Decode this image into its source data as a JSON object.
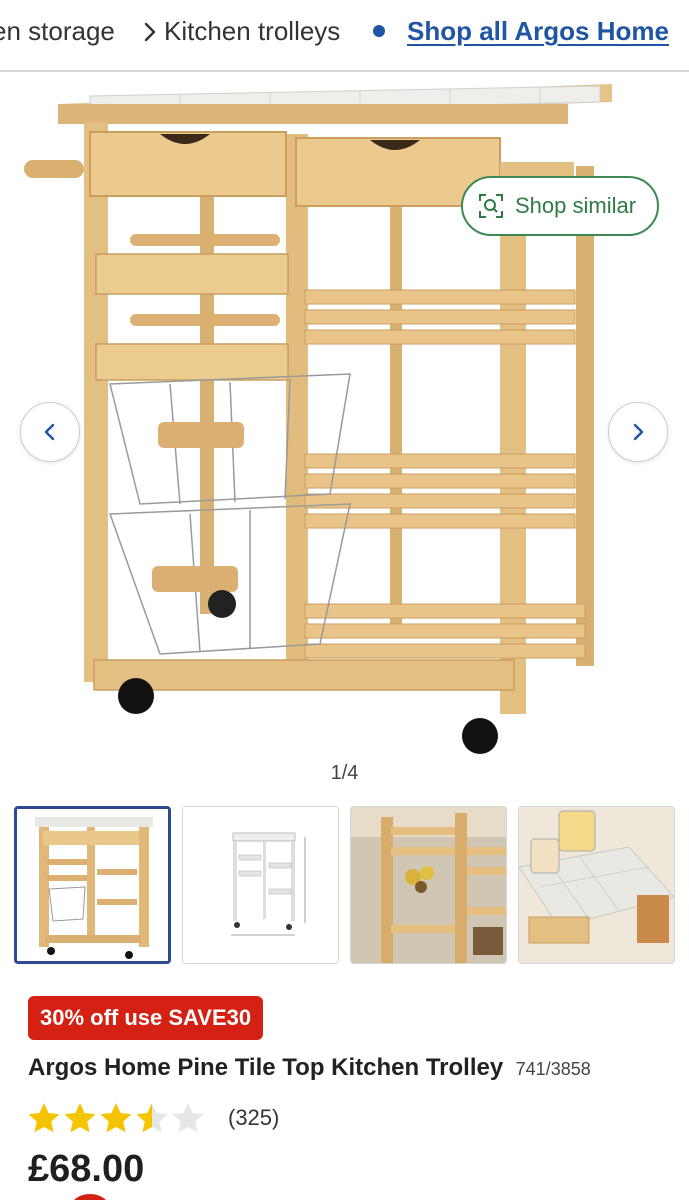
{
  "breadcrumb": {
    "previous": "en storage",
    "current": "Kitchen trolleys",
    "shop_all": "Shop all Argos Home"
  },
  "gallery": {
    "shop_similar": "Shop similar",
    "pager": "1/4"
  },
  "product": {
    "promo": "30% off use SAVE30",
    "title": "Argos Home Pine Tile Top Kitchen Trolley",
    "sku": "741/3858",
    "rating": 3.5,
    "rating_max": 5,
    "review_count": "(325)",
    "price": "£68.00"
  },
  "colors": {
    "brand_blue": "#1f55a4",
    "promo_red": "#d42114",
    "star_yellow": "#f5c400",
    "similar_green": "#2f7a45"
  }
}
